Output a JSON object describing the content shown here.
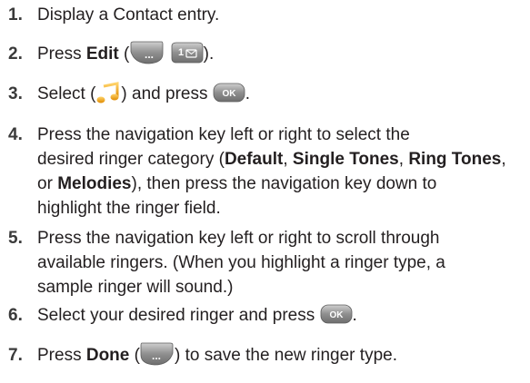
{
  "steps": [
    {
      "num": "1.",
      "lines": [
        [
          {
            "t": "Display a Contact entry."
          }
        ]
      ]
    },
    {
      "num": "2.",
      "lines": [
        [
          {
            "t": "Press "
          },
          {
            "b": "Edit"
          },
          {
            "t": " ("
          },
          {
            "icon": "softkey"
          },
          {
            "t": " "
          },
          {
            "icon": "key-1"
          },
          {
            "t": ")."
          }
        ]
      ]
    },
    {
      "num": "3.",
      "lines": [
        [
          {
            "t": "Select ("
          },
          {
            "icon": "ringer"
          },
          {
            "t": ") and press "
          },
          {
            "icon": "ok"
          },
          {
            "t": "."
          }
        ]
      ]
    },
    {
      "num": "4.",
      "lines": [
        [
          {
            "t": "Press the navigation key left or right to select the"
          }
        ],
        [
          {
            "t": "desired ringer category ("
          },
          {
            "b": "Default"
          },
          {
            "t": ", "
          },
          {
            "b": "Single Tones"
          },
          {
            "t": ", "
          },
          {
            "b": "Ring Tones"
          },
          {
            "t": ","
          }
        ],
        [
          {
            "t": "or "
          },
          {
            "b": "Melodies"
          },
          {
            "t": "), then press the navigation key down to"
          }
        ],
        [
          {
            "t": "highlight the ringer field."
          }
        ]
      ]
    },
    {
      "num": "5.",
      "lines": [
        [
          {
            "t": "Press the navigation key left or right to scroll through"
          }
        ],
        [
          {
            "t": "available ringers. (When you highlight a ringer type, a"
          }
        ],
        [
          {
            "t": "sample ringer will sound.)"
          }
        ]
      ]
    },
    {
      "num": "6.",
      "lines": [
        [
          {
            "t": "Select your desired ringer and press "
          },
          {
            "icon": "ok"
          },
          {
            "t": "."
          }
        ]
      ]
    },
    {
      "num": "7.",
      "lines": [
        [
          {
            "t": "Press "
          },
          {
            "b": "Done"
          },
          {
            "t": " ("
          },
          {
            "icon": "softkey-right"
          },
          {
            "t": ") to save the new ringer type."
          }
        ]
      ]
    }
  ],
  "icons": {
    "softkey": {
      "name": "left-softkey-icon",
      "label": "...",
      "color": "#9a9a9a"
    },
    "softkey-right": {
      "name": "right-softkey-icon",
      "label": "...",
      "color": "#9a9a9a"
    },
    "key-1": {
      "name": "key-1-icon",
      "label": "1",
      "color": "#9a9a9a"
    },
    "ringer": {
      "name": "ringer-icon",
      "color": "#f2a51c"
    },
    "ok": {
      "name": "ok-key-icon",
      "label": "OK",
      "color": "#9a9a9a"
    }
  }
}
